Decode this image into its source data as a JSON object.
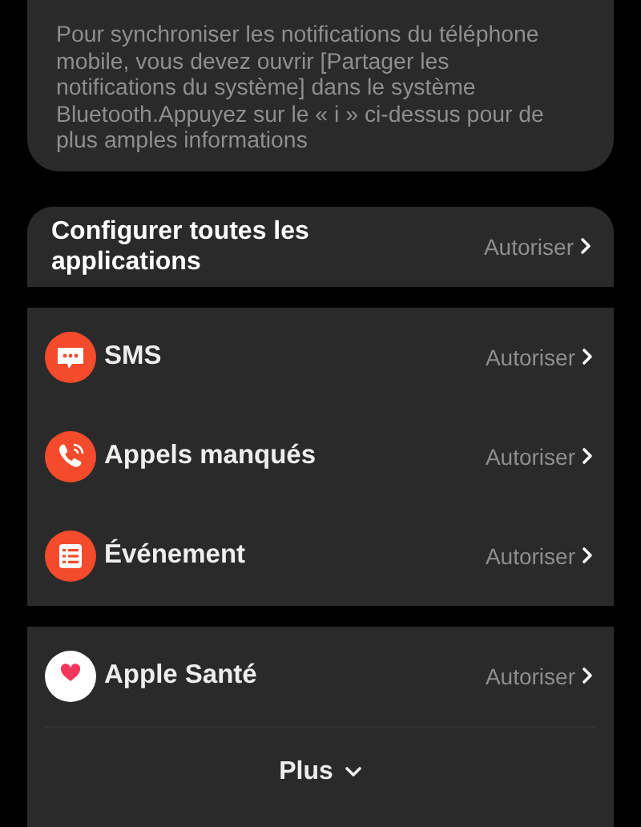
{
  "info_card": {
    "text": "Pour synchroniser les notifications du téléphone mobile, vous devez ouvrir [Partager les notifications du système] dans le système Bluetooth.Appuyez sur le « i » ci-dessus pour de plus amples informations"
  },
  "all_apps": {
    "label": "Configurer toutes les applications",
    "action": "Autoriser"
  },
  "apps": [
    {
      "kind": "message",
      "label": "SMS",
      "action": "Autoriser"
    },
    {
      "kind": "phone",
      "label": "Appels manqués",
      "action": "Autoriser"
    },
    {
      "kind": "list",
      "label": "Événement",
      "action": "Autoriser"
    }
  ],
  "more_apps": [
    {
      "kind": "heart",
      "label": "Apple Santé",
      "action": "Autoriser"
    }
  ],
  "more_button": {
    "label": "Plus"
  }
}
